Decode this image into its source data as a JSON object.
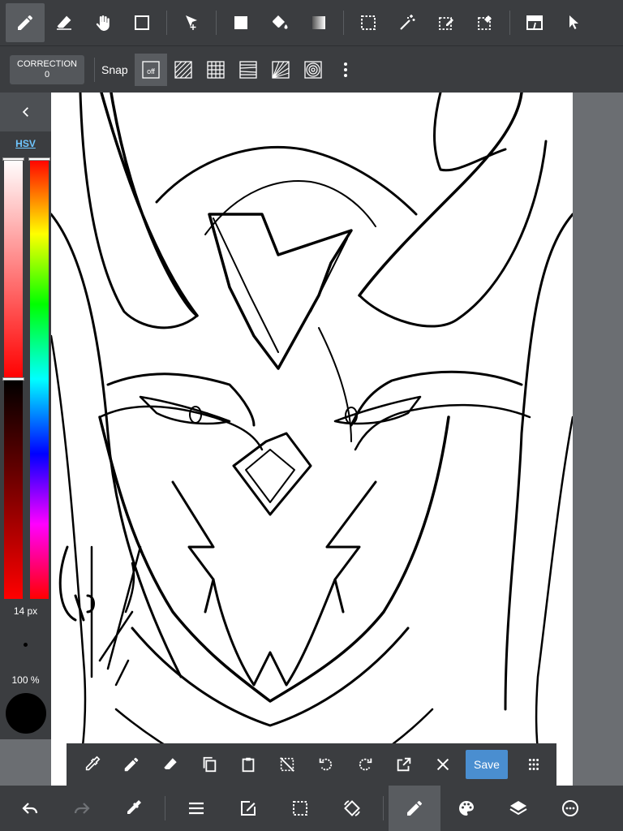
{
  "sub_bar": {
    "correction_label": "CORRECTION",
    "correction_value": "0",
    "snap_label": "Snap",
    "snap_off": "off"
  },
  "left_panel": {
    "mode_label": "HSV",
    "brush_size": "14 px",
    "opacity": "100 %",
    "current_color": "#000000",
    "sv_level": 0.5,
    "hue_level": 0.0
  },
  "float_bar": {
    "save_label": "Save"
  },
  "colors": {
    "toolbar_bg": "#3b3d40",
    "active_bg": "#595c60",
    "accent": "#4a8ed0",
    "hsv_link": "#6fc6ff"
  }
}
